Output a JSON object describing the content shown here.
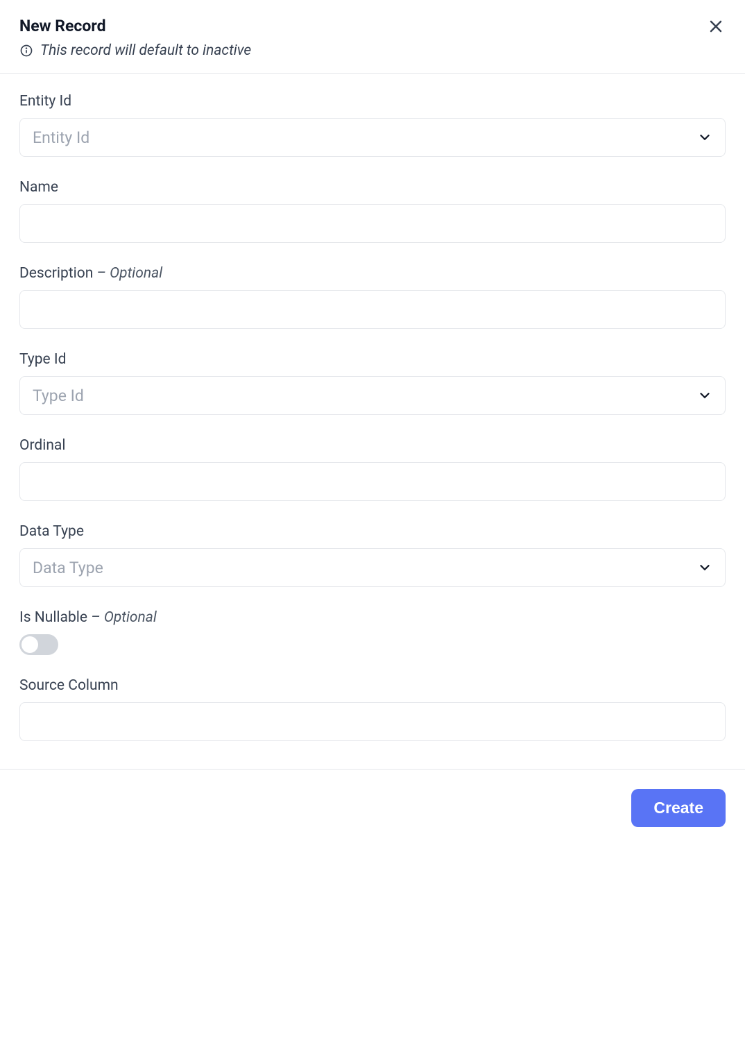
{
  "header": {
    "title": "New Record",
    "subtitle": "This record will default to inactive"
  },
  "fields": {
    "entityId": {
      "label": "Entity Id",
      "placeholder": "Entity Id"
    },
    "name": {
      "label": "Name"
    },
    "description": {
      "label": "Description",
      "optional": "– Optional"
    },
    "typeId": {
      "label": "Type Id",
      "placeholder": "Type Id"
    },
    "ordinal": {
      "label": "Ordinal"
    },
    "dataType": {
      "label": "Data Type",
      "placeholder": "Data Type"
    },
    "isNullable": {
      "label": "Is Nullable",
      "optional": "– Optional"
    },
    "sourceColumn": {
      "label": "Source Column"
    }
  },
  "footer": {
    "createLabel": "Create"
  }
}
